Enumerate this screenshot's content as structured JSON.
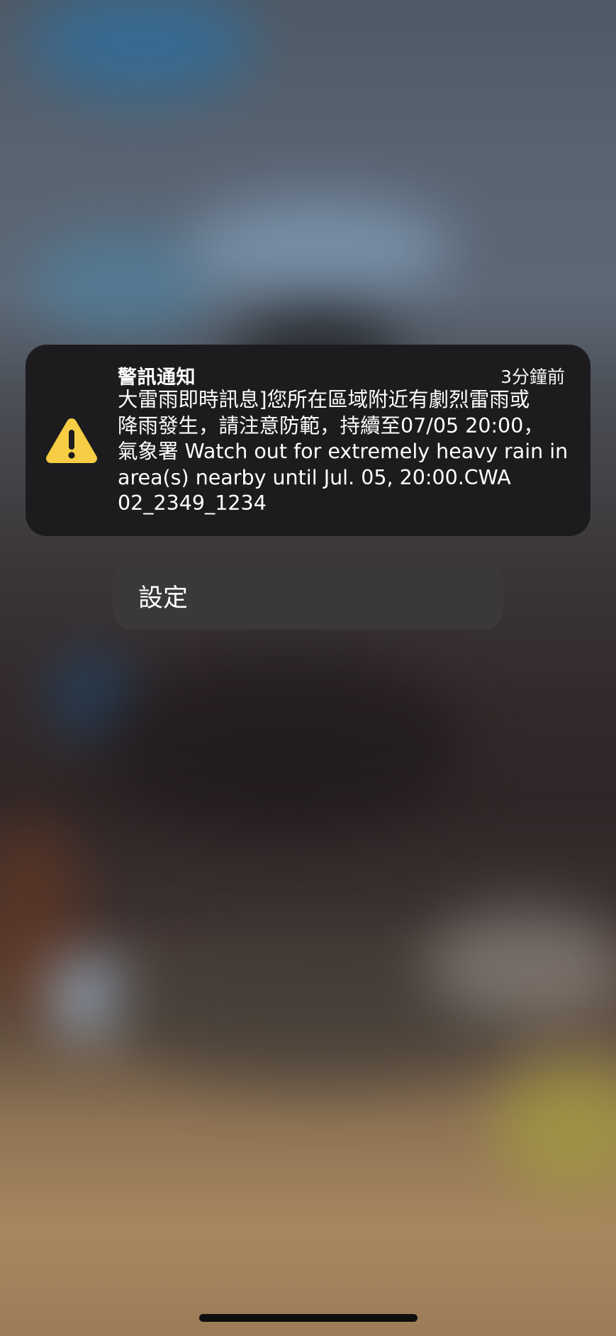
{
  "notification": {
    "title": "警訊通知",
    "time": "3分鐘前",
    "body_lines": [
      "大雷雨即時訊息]您所在區域附近有劇烈雷雨或",
      "降雨發生，請注意防範，持續至07/05 20:00，",
      "氣象署 Watch out for extremely heavy rain in",
      "area(s) nearby until Jul. 05, 20:00.CWA",
      "02_2349_1234"
    ],
    "icon": "warning-triangle-icon",
    "icon_color": "#f7cd45"
  },
  "settings": {
    "label": "設定"
  },
  "colors": {
    "card_background": "#1c1c1e",
    "button_background": "#3a3938"
  }
}
